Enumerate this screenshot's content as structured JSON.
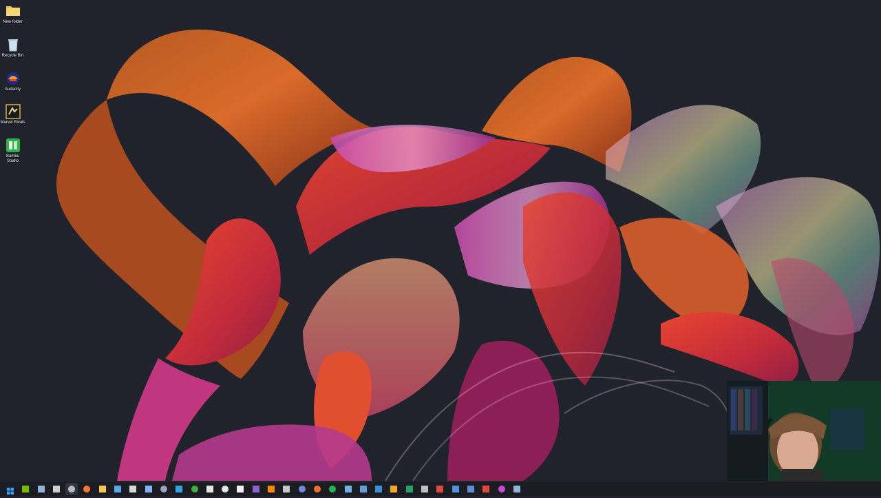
{
  "desktop": {
    "icons": [
      {
        "label": "New folder",
        "icon": "folder-icon"
      },
      {
        "label": "Recycle Bin",
        "icon": "recycle-bin-icon"
      },
      {
        "label": "Audacity",
        "icon": "audacity-icon"
      },
      {
        "label": "Marvel Rivals",
        "icon": "marvel-rivals-icon"
      },
      {
        "label": "Bambu Studio",
        "icon": "bambu-studio-icon"
      }
    ]
  },
  "taskbar": {
    "items": [
      {
        "icon": "start-icon",
        "color": "#3aa0ff"
      },
      {
        "icon": "nvidia-icon",
        "color": "#76b900"
      },
      {
        "icon": "steam-icon",
        "color": "#8fb3d9"
      },
      {
        "icon": "terminal-icon",
        "color": "#cfcfcf"
      },
      {
        "icon": "obs-icon",
        "color": "#bdbdbd",
        "active": true
      },
      {
        "icon": "firefox-icon",
        "color": "#ff7a2f"
      },
      {
        "icon": "file-explorer-icon",
        "color": "#f4c84a"
      },
      {
        "icon": "monitor-icon",
        "color": "#5aa8e8"
      },
      {
        "icon": "calendar-icon",
        "color": "#d7d7d7"
      },
      {
        "icon": "palette-icon",
        "color": "#7fb5ff"
      },
      {
        "icon": "settings-icon",
        "color": "#9aa4b8"
      },
      {
        "icon": "notes-icon",
        "color": "#2fa4e0"
      },
      {
        "icon": "xbox-icon",
        "color": "#3cb043"
      },
      {
        "icon": "capcut-icon",
        "color": "#e5e5e5"
      },
      {
        "icon": "github-icon",
        "color": "#e8e8e8"
      },
      {
        "icon": "unity-icon",
        "color": "#f0f0f0"
      },
      {
        "icon": "video-editor-icon",
        "color": "#8a63d2"
      },
      {
        "icon": "vlc-icon",
        "color": "#ff8800"
      },
      {
        "icon": "clipboard-icon",
        "color": "#c8c8c8"
      },
      {
        "icon": "discord-icon",
        "color": "#7289da"
      },
      {
        "icon": "origin-icon",
        "color": "#f56c2d"
      },
      {
        "icon": "spotify-icon",
        "color": "#1db954"
      },
      {
        "icon": "mail-icon",
        "color": "#6fb1e0"
      },
      {
        "icon": "network-icon",
        "color": "#5fa0d8"
      },
      {
        "icon": "maps-icon",
        "color": "#3a8fd9"
      },
      {
        "icon": "warning-icon",
        "color": "#f4a524"
      },
      {
        "icon": "spreadsheet-icon",
        "color": "#21a366"
      },
      {
        "icon": "command-prompt-icon",
        "color": "#bfbfbf"
      },
      {
        "icon": "app-update-icon",
        "color": "#e04a3a"
      },
      {
        "icon": "search-app-icon",
        "color": "#4f8fe0"
      },
      {
        "icon": "blender-icon",
        "color": "#5f8bd8"
      },
      {
        "icon": "app-update-icon-2",
        "color": "#e04a3a"
      },
      {
        "icon": "brave-icon",
        "color": "#c64ad6"
      },
      {
        "icon": "steam-icon-2",
        "color": "#8fb3d9"
      }
    ]
  }
}
